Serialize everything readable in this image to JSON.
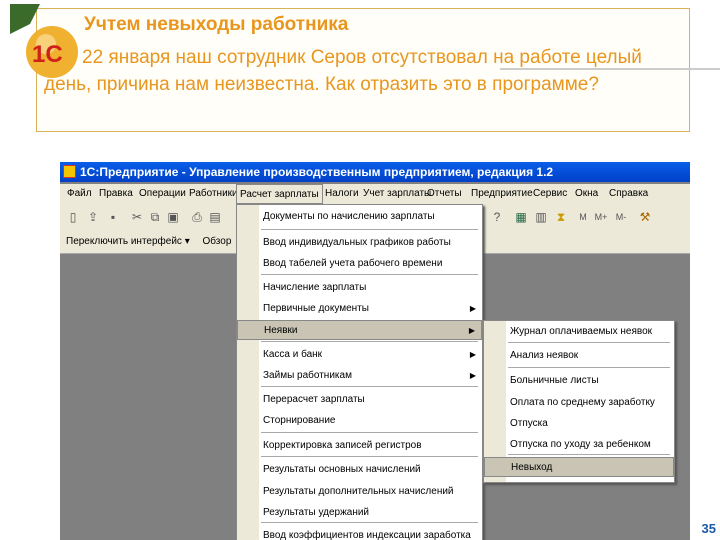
{
  "slide": {
    "title": "Учтем невыходы работника",
    "question": "22 января наш сотрудник Серов отсутствовал на работе целый день, причина нам неизвестна. Как отразить это в программе?",
    "logo_text": "1С",
    "page_number": "35"
  },
  "window": {
    "title": "1С:Предприятие - Управление производственным предприятием, редакция 1.2"
  },
  "menubar": [
    "Файл",
    "Правка",
    "Операции",
    "Работники",
    "Расчет зарплаты",
    "Налоги",
    "Учет зарплаты",
    "Отчеты",
    "Предприятие",
    "Сервис",
    "Окна",
    "Справка"
  ],
  "toolbar2": {
    "switch_interface": "Переключить интерфейс ▾",
    "overview": "Обзор"
  },
  "menu": [
    "Документы по начислению зарплаты",
    "Ввод индивидуальных графиков работы",
    "Ввод табелей учета рабочего времени",
    "Начисление зарплаты",
    "Первичные документы",
    "Неявки",
    "Касса и банк",
    "Займы работникам",
    "Перерасчет зарплаты",
    "Сторнирование",
    "Корректировка записей регистров",
    "Результаты основных начислений",
    "Результаты дополнительных начислений",
    "Результаты удержаний",
    "Ввод коэффициентов индексации заработка"
  ],
  "submenu": [
    "Журнал оплачиваемых неявок",
    "Анализ неявок",
    "Больничные листы",
    "Оплата по среднему заработку",
    "Отпуска",
    "Отпуска по уходу за ребенком",
    "Невыход"
  ]
}
